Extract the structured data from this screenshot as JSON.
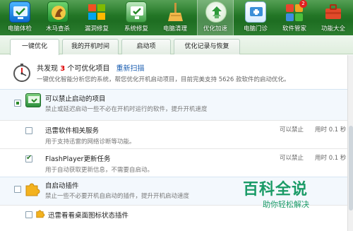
{
  "toolbar": {
    "items": [
      {
        "label": "电脑体检",
        "icon": "monitor-check-icon"
      },
      {
        "label": "木马查杀",
        "icon": "horse-icon"
      },
      {
        "label": "漏洞修复",
        "icon": "windows-icon"
      },
      {
        "label": "系统修复",
        "icon": "system-repair-icon"
      },
      {
        "label": "电脑清理",
        "icon": "broom-icon"
      },
      {
        "label": "优化加速",
        "icon": "rocket-icon"
      },
      {
        "label": "电脑门诊",
        "icon": "clinic-icon"
      },
      {
        "label": "软件管家",
        "icon": "apps-icon",
        "badge": "2"
      },
      {
        "label": "功能大全",
        "icon": "toolbox-icon"
      }
    ],
    "active_index": 5
  },
  "tabs": [
    {
      "label": "一键优化"
    },
    {
      "label": "我的开机时间"
    },
    {
      "label": "启动项"
    },
    {
      "label": "优化记录与恢复"
    }
  ],
  "summary": {
    "title_prefix": "共发现",
    "count": "3",
    "title_suffix": "个可优化项目",
    "rescan": "重新扫描",
    "description": "一键优化智能分析您的系统，帮您优化开机启动项目，目前完美支持 5626 款软件的启动优化。"
  },
  "sections": [
    {
      "title": "可以禁止启动的项目",
      "description": "禁止或延迟启动一些不必在开机时运行的软件，提升开机速度",
      "items": [
        {
          "name": "迅雷软件相关服务",
          "desc": "用于支持迅雷的网络诊断等功能。",
          "status": "可以禁止",
          "time": "用时 0.1 秒",
          "checked": false
        },
        {
          "name": "FlashPlayer更新任务",
          "desc": "用于自动获取更新信息，不需要自启动。",
          "status": "可以禁止",
          "time": "用时 0.1 秒",
          "checked": true
        }
      ]
    },
    {
      "title": "自启动插件",
      "description": "禁止一些不必要开机自启动的插件，提升开机启动速度",
      "items": [
        {
          "name": "迅雷看看桌面图标状态插件",
          "checked": false
        }
      ]
    }
  ],
  "watermark": {
    "big": "百科全说",
    "small": "助你轻松解决"
  },
  "colors": {
    "toolbar_green": "#1e6e22",
    "accent_red": "#d00000",
    "link_blue": "#1a5db0",
    "watermark_green": "#1b9b67"
  }
}
